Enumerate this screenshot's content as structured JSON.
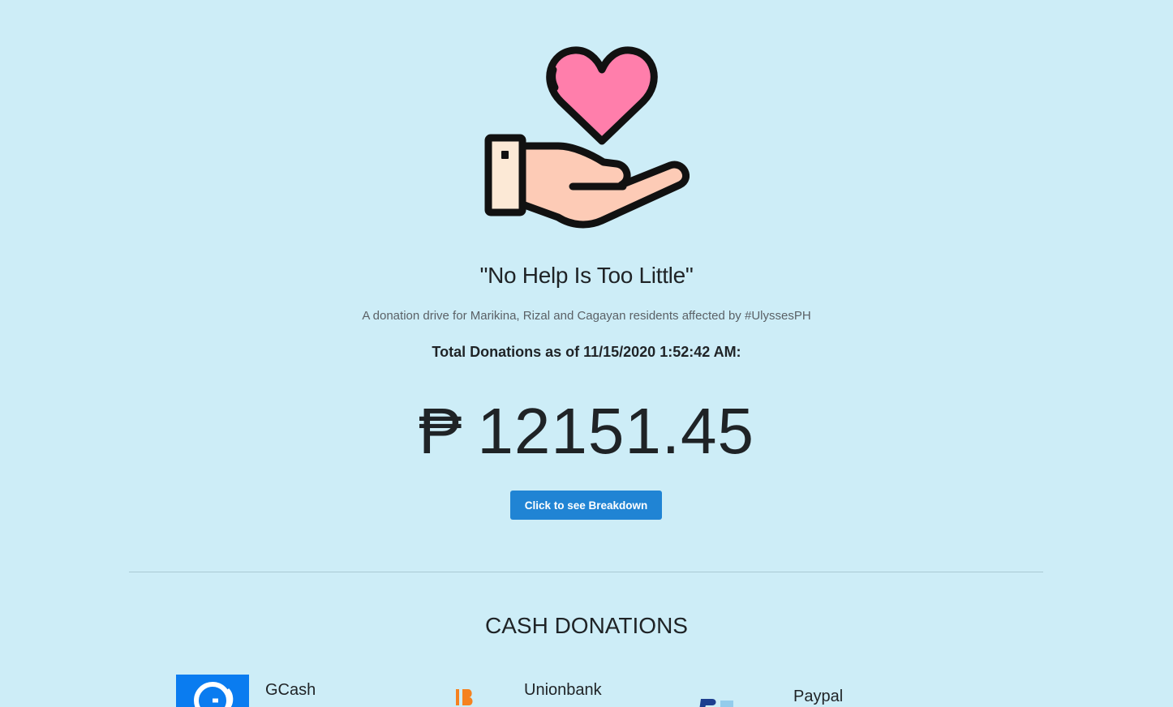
{
  "hero": {
    "icon": "hand-heart-icon",
    "title": "\"No Help Is Too Little\"",
    "subtitle": "A donation drive for Marikina, Rizal and Cagayan residents affected by #UlyssesPH",
    "total_label": "Total Donations as of 11/15/2020 1:52:42 AM:",
    "currency_symbol": "₱",
    "amount": "12151.45",
    "breakdown_button": "Click to see Breakdown"
  },
  "cash_donations": {
    "heading": "CASH DONATIONS",
    "methods": [
      {
        "name": "GCash",
        "icon": "gcash-logo-icon"
      },
      {
        "name": "Unionbank",
        "icon": "unionbank-logo-icon"
      },
      {
        "name": "Paypal",
        "icon": "paypal-logo-icon"
      }
    ]
  },
  "colors": {
    "background": "#cdedf7",
    "button": "#2084d4",
    "heart": "#ff7eab",
    "hand": "#fdcbb6",
    "cuff": "#fce9d6",
    "gcash": "#0a7cf0"
  }
}
